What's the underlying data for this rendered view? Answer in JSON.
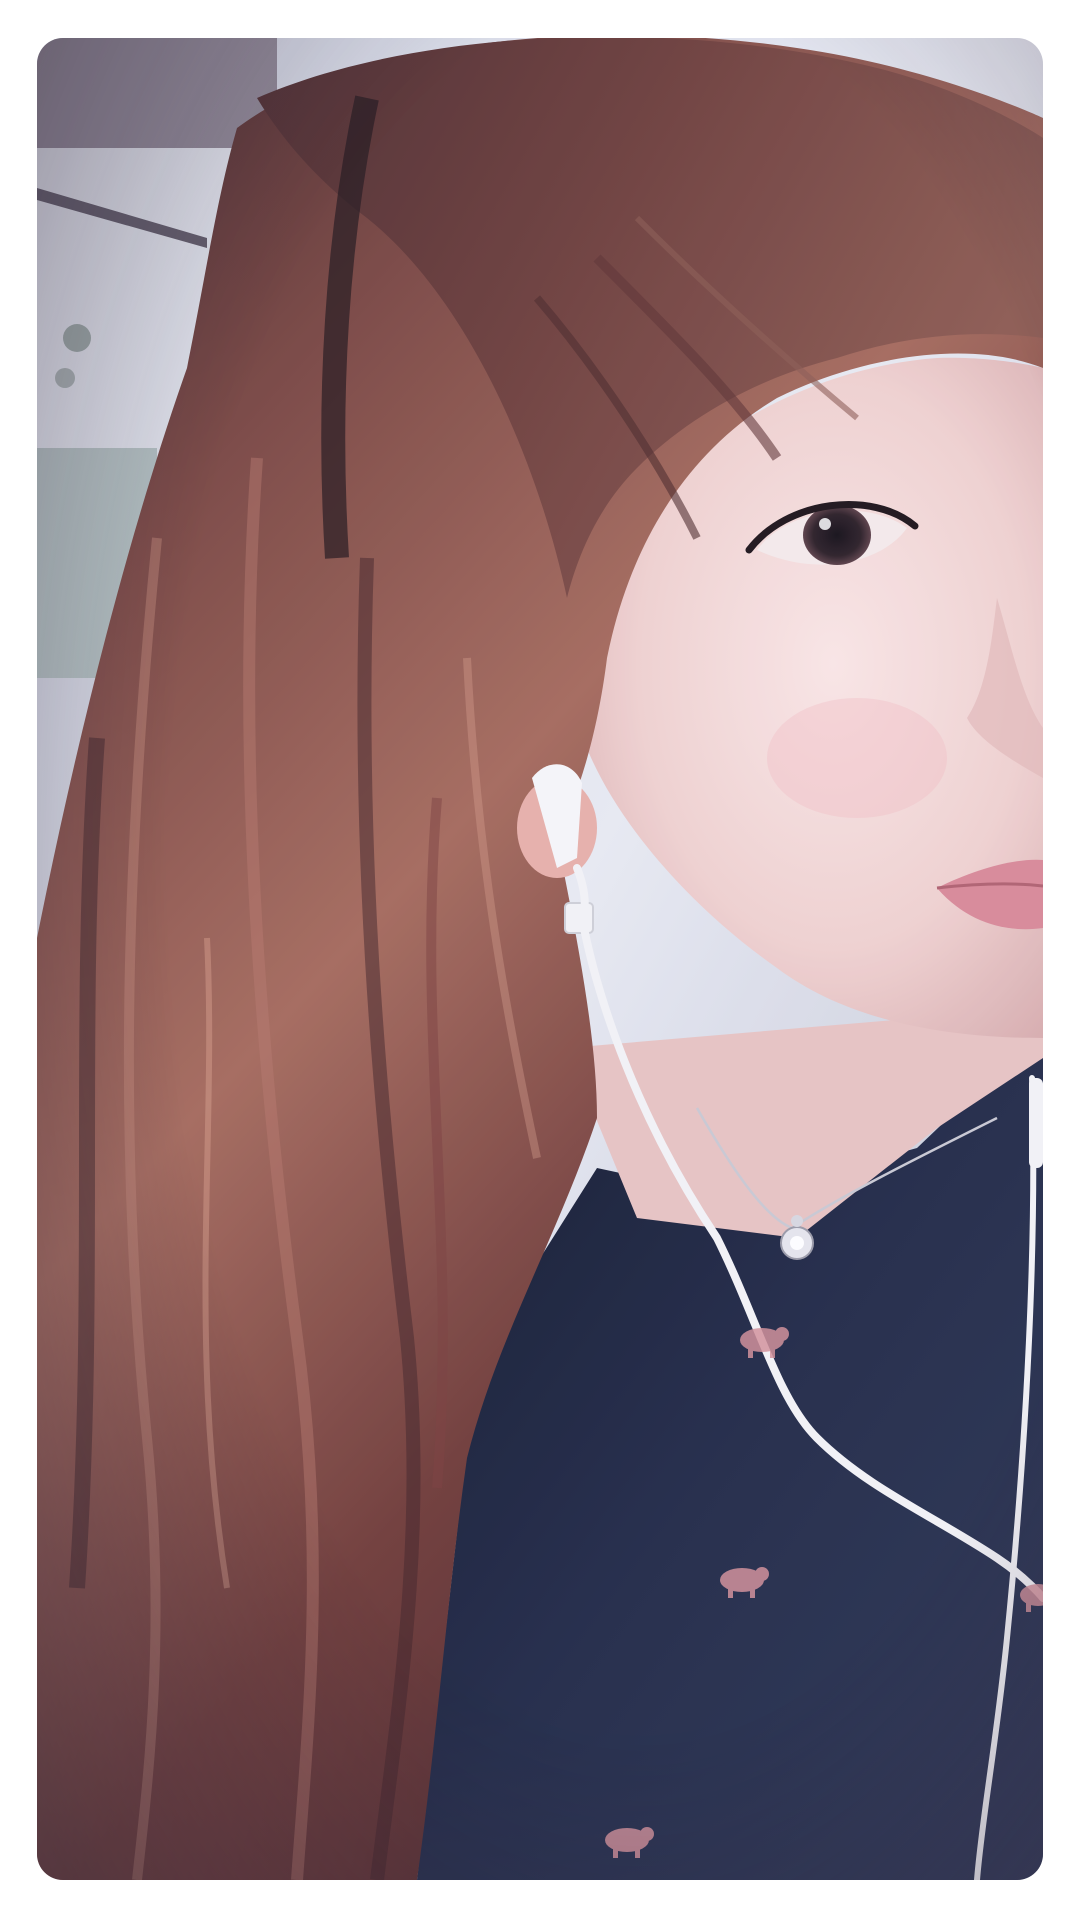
{
  "photo": {
    "subject": "selfie-portrait",
    "style": "vignette-filtered-photo",
    "colors": {
      "page_background": "#ffffff",
      "hair": "#5a2f2c",
      "hair_highlight": "#a8685a",
      "skin": "#f1d2cf",
      "shirt": "#1c2440",
      "earphone_cable": "#f4f4f6",
      "lips": "#d98896",
      "print_motif": "#d28f98",
      "window_light": "#e4e7ee",
      "vignette": "#2a2030"
    },
    "elements": [
      "background-window",
      "hair",
      "face",
      "eye",
      "lips",
      "earbud",
      "earphone-cable",
      "necklace",
      "pendant",
      "shirt",
      "pig-print"
    ]
  }
}
